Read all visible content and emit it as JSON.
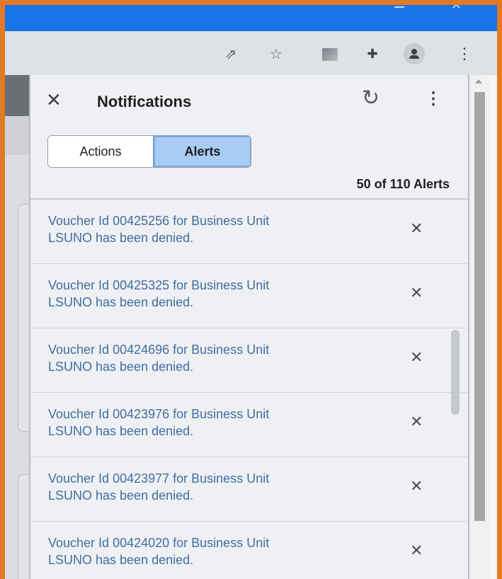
{
  "browser": {
    "icons": [
      "share-icon",
      "star-icon",
      "extension-image-icon",
      "puzzle-icon",
      "profile-icon",
      "menu-kebab-icon"
    ]
  },
  "panel": {
    "title": "Notifications",
    "tabs": [
      {
        "label": "Actions",
        "selected": false
      },
      {
        "label": "Alerts",
        "selected": true
      }
    ],
    "count_text": "50 of 110 Alerts",
    "alerts": [
      {
        "line1": "Voucher Id 00425256 for Business Unit",
        "line2": "LSUNO has been denied."
      },
      {
        "line1": "Voucher Id 00425325 for Business Unit",
        "line2": "LSUNO has been denied."
      },
      {
        "line1": "Voucher Id 00424696 for Business Unit",
        "line2": "LSUNO has been denied."
      },
      {
        "line1": "Voucher Id 00423976 for Business Unit",
        "line2": "LSUNO has been denied."
      },
      {
        "line1": "Voucher Id 00423977 for Business Unit",
        "line2": "LSUNO has been denied."
      },
      {
        "line1": "Voucher Id 00424020 for Business Unit",
        "line2": "LSUNO has been denied."
      }
    ]
  },
  "colors": {
    "titlebar": "#1a73e8",
    "alert_link": "#3f6fa1",
    "selected_tab": "#a8ccf3"
  }
}
